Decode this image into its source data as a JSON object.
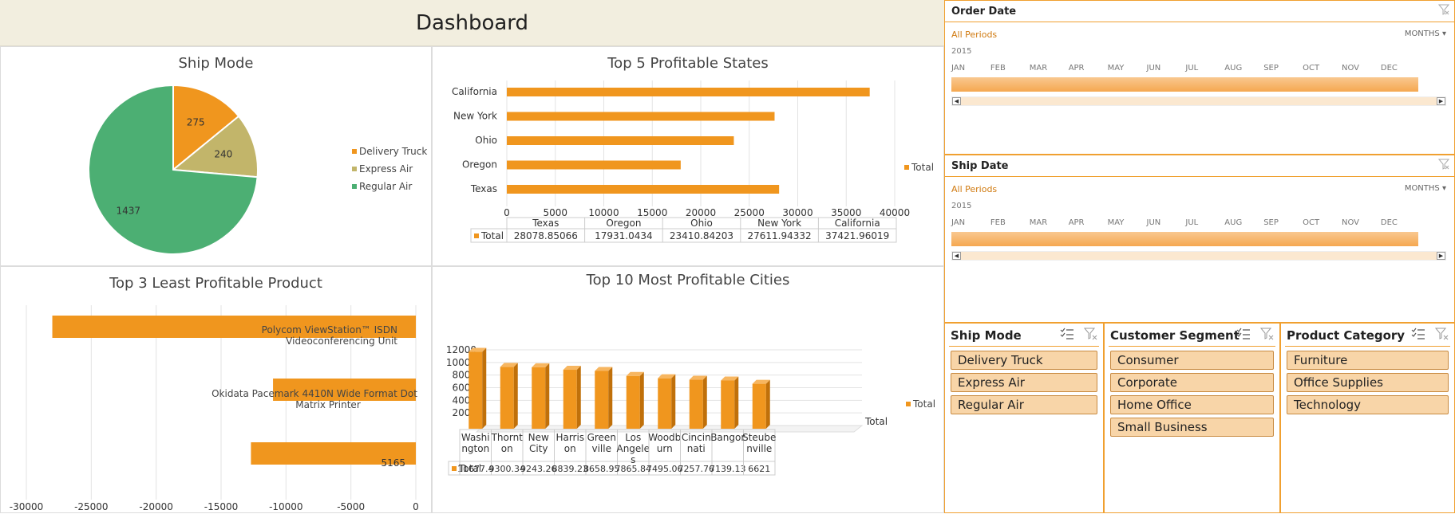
{
  "dashboard": {
    "title": "Dashboard"
  },
  "colors": {
    "orange": "#f0961e",
    "green": "#4caf73",
    "khaki": "#c2b56a",
    "timeline_border": "#f0a030",
    "slicer_item": "#f8d5a8"
  },
  "ship_mode_chart": {
    "title": "Ship Mode",
    "chart_data": {
      "type": "pie",
      "slices": [
        {
          "label": "Delivery Truck",
          "value": 275,
          "color": "#f0961e"
        },
        {
          "label": "Express Air",
          "value": 240,
          "color": "#c2b56a"
        },
        {
          "label": "Regular Air",
          "value": 1437,
          "color": "#4caf73"
        }
      ],
      "legend_position": "right"
    }
  },
  "states_chart": {
    "title": "Top 5 Profitable States",
    "chart_data": {
      "type": "bar",
      "orientation": "horizontal",
      "categories": [
        "California",
        "New York",
        "Ohio",
        "Oregon",
        "Texas"
      ],
      "values": [
        37421.96019,
        27611.94332,
        23410.84203,
        17931.0434,
        28078.85066
      ],
      "xlim": [
        0,
        40000
      ],
      "xticks": [
        "0",
        "5000",
        "10000",
        "15000",
        "20000",
        "25000",
        "30000",
        "35000",
        "40000"
      ],
      "legend": "Total",
      "table": {
        "row_label": "Total",
        "headers": [
          "Texas",
          "Oregon",
          "Ohio",
          "New York",
          "California"
        ],
        "values": [
          "28078.85066",
          "17931.0434",
          "23410.84203",
          "27611.94332",
          "37421.96019"
        ]
      }
    }
  },
  "products_chart": {
    "title": "Top 3 Least Profitable Product",
    "chart_data": {
      "type": "bar",
      "orientation": "horizontal",
      "bars": [
        {
          "label": "Polycom ViewStation™ ISDN Videoconferencing Unit",
          "value": -28000
        },
        {
          "label": "Okidata Pacemark 4410N Wide Format Dot Matrix Printer",
          "value": -11000
        },
        {
          "label": "5165",
          "value": -12700
        }
      ],
      "xlim": [
        -30000,
        0
      ],
      "xticks": [
        "-30000",
        "-25000",
        "-20000",
        "-15000",
        "-10000",
        "-5000",
        "0"
      ]
    }
  },
  "cities_chart": {
    "title": "Top 10 Most Profitable Cities",
    "chart_data": {
      "type": "bar",
      "categories": [
        "Washington",
        "Thornton",
        "New City",
        "Harrison",
        "Greenville",
        "Los Angeles",
        "Woodburn",
        "Cincinnati",
        "Bangor",
        "Steubenville"
      ],
      "category_labels": [
        "Washi ngton",
        "Thornt on",
        "New City",
        "Harris on",
        "Green ville",
        "Los Angele s",
        "Woodb urn",
        "Cincin nati",
        "Bangor",
        "Steube nville"
      ],
      "values": [
        11677.4,
        9300.34,
        9243.26,
        8839.23,
        8658.95,
        7865.84,
        7495.06,
        7257.76,
        7139.13,
        6621
      ],
      "value_labels": [
        "11677.4",
        "9300.34",
        "9243.26",
        "8839.23",
        "8658.95",
        "7865.84",
        "7495.06",
        "7257.76",
        "7139.13",
        "6621"
      ],
      "ylim": [
        0,
        12000
      ],
      "yticks": [
        "0",
        "2000",
        "4000",
        "6000",
        "8000",
        "10000",
        "12000"
      ],
      "legend": "Total",
      "row_label": "Total",
      "axis_label": "Total"
    }
  },
  "order_date_timeline": {
    "title": "Order Date",
    "period": "All Periods",
    "level": "MONTHS",
    "year": "2015",
    "months": [
      "JAN",
      "FEB",
      "MAR",
      "APR",
      "MAY",
      "JUN",
      "JUL",
      "AUG",
      "SEP",
      "OCT",
      "NOV",
      "DEC"
    ]
  },
  "ship_date_timeline": {
    "title": "Ship Date",
    "period": "All Periods",
    "level": "MONTHS",
    "year": "2015",
    "months": [
      "JAN",
      "FEB",
      "MAR",
      "APR",
      "MAY",
      "JUN",
      "JUL",
      "AUG",
      "SEP",
      "OCT",
      "NOV",
      "DEC"
    ]
  },
  "slicers": {
    "ship_mode": {
      "title": "Ship Mode",
      "items": [
        "Delivery Truck",
        "Express Air",
        "Regular Air"
      ]
    },
    "customer_segment": {
      "title": "Customer Segment",
      "items": [
        "Consumer",
        "Corporate",
        "Home Office",
        "Small Business"
      ]
    },
    "product_category": {
      "title": "Product Category",
      "items": [
        "Furniture",
        "Office Supplies",
        "Technology"
      ]
    }
  }
}
